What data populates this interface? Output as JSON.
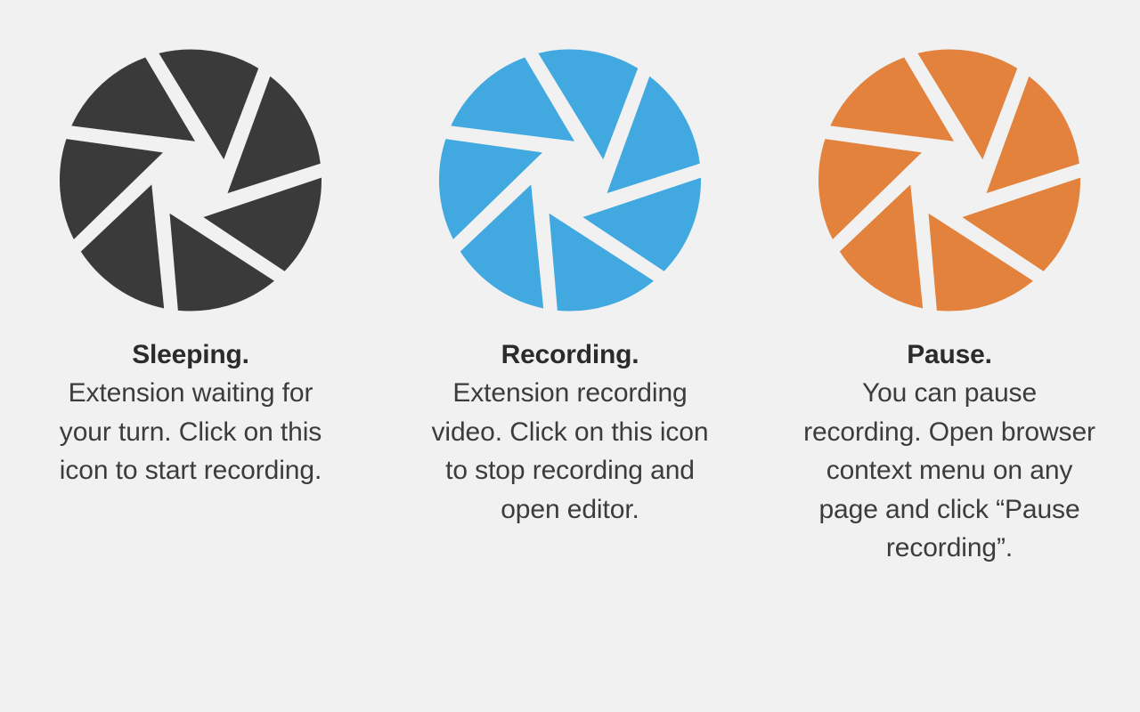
{
  "page": {
    "background_color": "#f1f1f1",
    "text_color": "#3c3c3c",
    "title_color": "#2b2b2b"
  },
  "cards": [
    {
      "id": "sleeping",
      "icon_name": "aperture-icon-sleeping",
      "icon_color": "#3a3a3a",
      "title": "Sleeping.",
      "description": "Extension waiting for your turn. Click on this icon to start recording."
    },
    {
      "id": "recording",
      "icon_name": "aperture-icon-recording",
      "icon_color": "#41a9e0",
      "title": "Recording.",
      "description": "Extension recording video. Click on this icon to stop recording and open editor."
    },
    {
      "id": "pause",
      "icon_name": "aperture-icon-pause",
      "icon_color": "#e2823c",
      "title": "Pause.",
      "description": "You can pause recording. Open browser context menu on any page and click “Pause recording”."
    }
  ]
}
